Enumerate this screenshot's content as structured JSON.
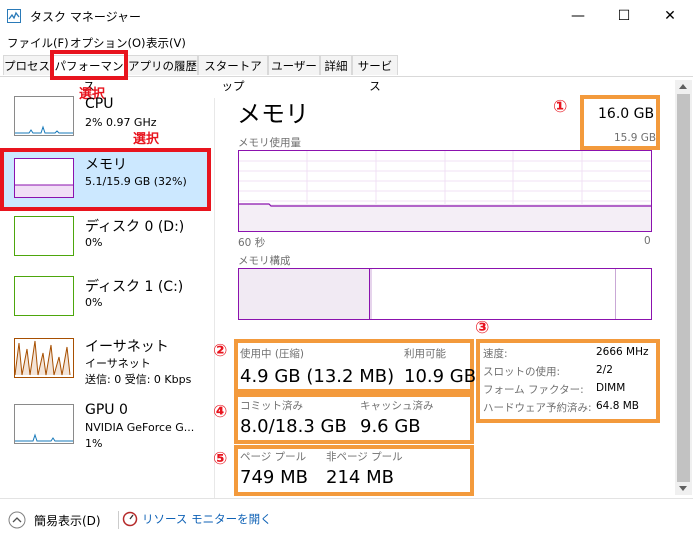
{
  "window": {
    "title": "タスク マネージャー",
    "min": "—",
    "max": "☐",
    "close": "✕"
  },
  "menu": [
    "ファイル(F)",
    "オプション(O)",
    "表示(V)"
  ],
  "tabs": [
    "プロセス",
    "パフォーマンス",
    "アプリの履歴",
    "スタートアップ",
    "ユーザー",
    "詳細",
    "サービス"
  ],
  "annotations": {
    "select": "選択",
    "n1": "①",
    "n2": "②",
    "n3": "③",
    "n4": "④",
    "n5": "⑤"
  },
  "sidebar": [
    {
      "title": "CPU",
      "sub1": "2%  0.97 GHz",
      "sub2": ""
    },
    {
      "title": "メモリ",
      "sub1": "5.1/15.9 GB (32%)",
      "sub2": ""
    },
    {
      "title": "ディスク 0 (D:)",
      "sub1": "0%",
      "sub2": ""
    },
    {
      "title": "ディスク 1 (C:)",
      "sub1": "0%",
      "sub2": ""
    },
    {
      "title": "イーサネット",
      "sub1": "イーサネット",
      "sub2": "送信: 0 受信: 0 Kbps"
    },
    {
      "title": "GPU 0",
      "sub1": "NVIDIA GeForce G...",
      "sub2": "1%"
    }
  ],
  "main": {
    "heading": "メモリ",
    "total": "16.0 GB",
    "usable": "15.9 GB",
    "usage_caption": "メモリ使用量",
    "usage_axis_left": "60 秒",
    "usage_axis_right": "0",
    "composition_caption": "メモリ構成",
    "stats": {
      "in_use_label": "使用中 (圧縮)",
      "in_use_value": "4.9 GB (13.2 MB)",
      "available_label": "利用可能",
      "available_value": "10.9 GB",
      "committed_label": "コミット済み",
      "committed_value": "8.0/18.3 GB",
      "cached_label": "キャッシュ済み",
      "cached_value": "9.6 GB",
      "paged_label": "ページ プール",
      "paged_value": "749 MB",
      "nonpaged_label": "非ページ プール",
      "nonpaged_value": "214 MB"
    },
    "details": [
      {
        "label": "速度:",
        "value": "2666 MHz"
      },
      {
        "label": "スロットの使用:",
        "value": "2/2"
      },
      {
        "label": "フォーム ファクター:",
        "value": "DIMM"
      },
      {
        "label": "ハードウェア予約済み:",
        "value": "64.8 MB"
      }
    ]
  },
  "footer": {
    "fewer_details": "簡易表示(D)",
    "open_monitor": "リソース モニターを開く"
  },
  "colors": {
    "memory_line": "#8b12ae",
    "memory_fill": "#f4f2f4",
    "cpu_line": "#1779ba",
    "disk_line": "#4da60c",
    "net_line": "#a74f01",
    "annot_red": "#e8141e",
    "annot_orange": "#f39a3c",
    "selected_bg": "#cce8ff"
  }
}
